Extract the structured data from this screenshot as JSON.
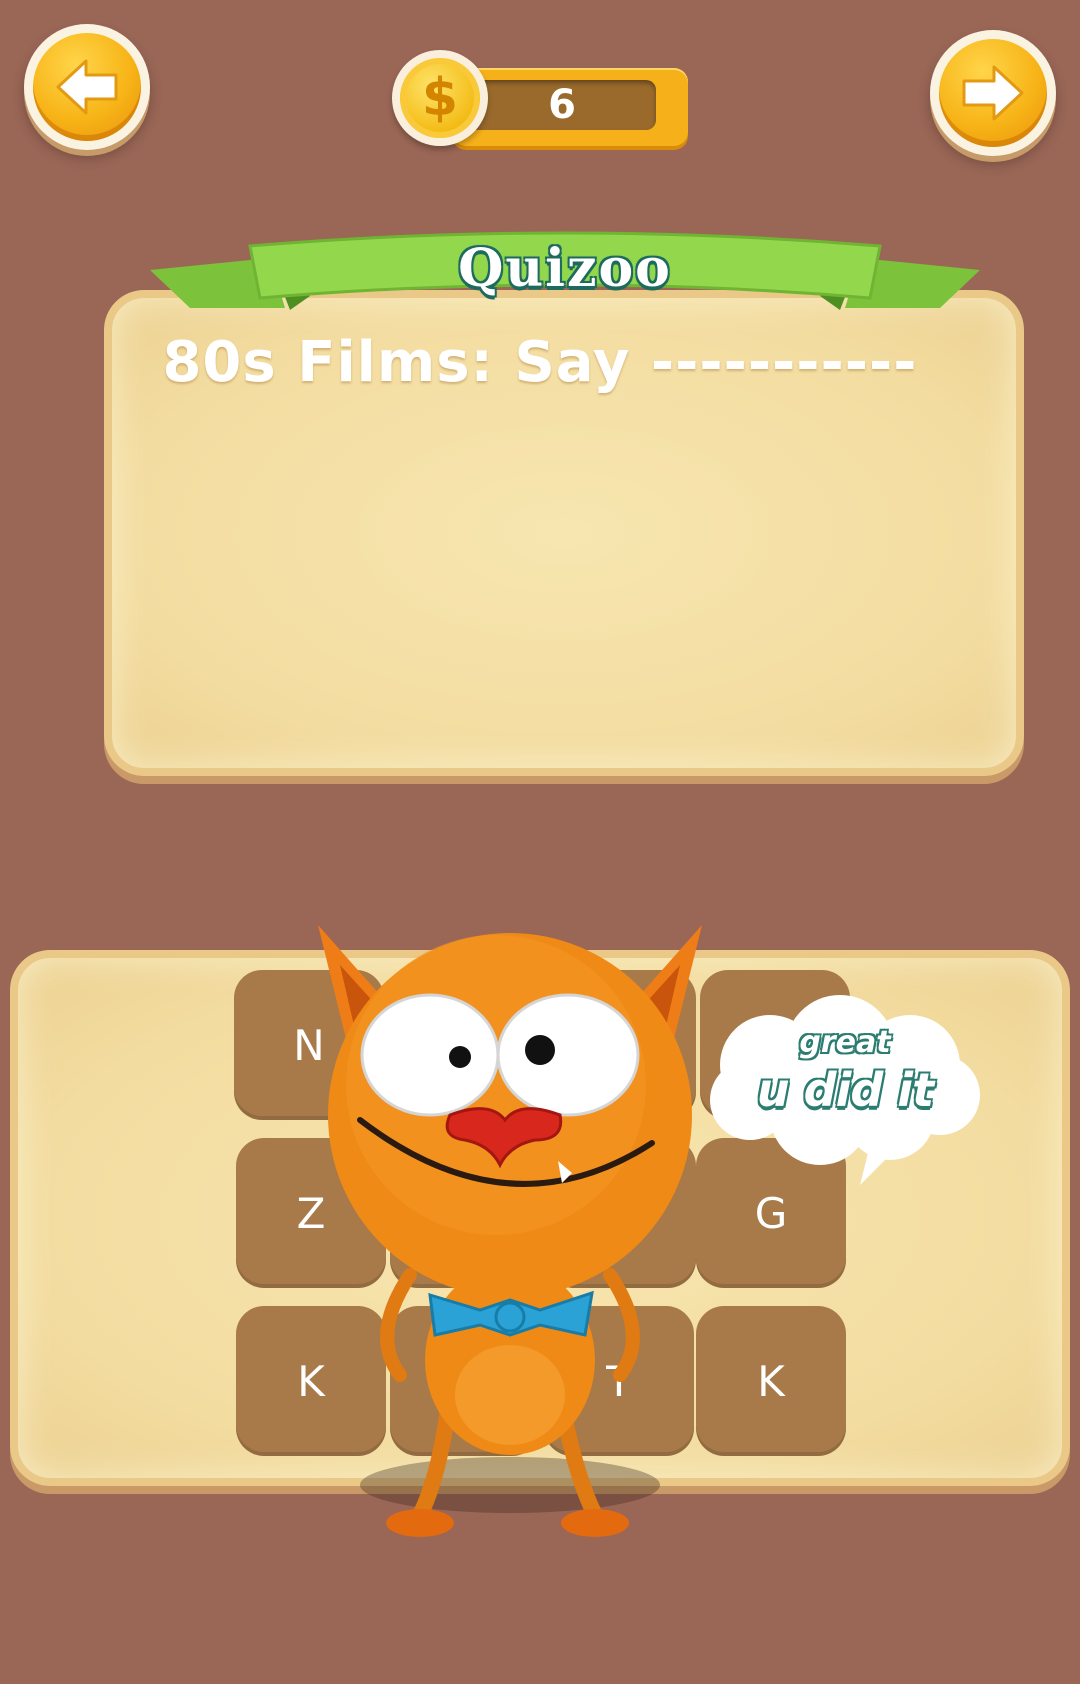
{
  "header": {
    "coins": "6",
    "back_icon": "arrow-left-icon",
    "forward_icon": "arrow-right-icon",
    "coin_icon": "dollar-coin-icon",
    "coin_symbol": "$"
  },
  "banner": {
    "title": "Quizoo"
  },
  "question": {
    "text": "80s Films: Say -----------"
  },
  "letters": [
    {
      "letter": "N"
    },
    {
      "letter": ""
    },
    {
      "letter": ""
    },
    {
      "letter": ""
    },
    {
      "letter": "Z"
    },
    {
      "letter": ""
    },
    {
      "letter": ""
    },
    {
      "letter": "G"
    },
    {
      "letter": "K"
    },
    {
      "letter": ""
    },
    {
      "letter": "T"
    },
    {
      "letter": "K"
    }
  ],
  "speech_bubble": {
    "line1": "great",
    "line2": "u did it"
  },
  "colors": {
    "background": "#9a6656",
    "accent_orange": "#f7b417",
    "ribbon_green": "#8fd44a",
    "tile_brown": "#a87a49",
    "parchment": "#f4dfa3"
  }
}
